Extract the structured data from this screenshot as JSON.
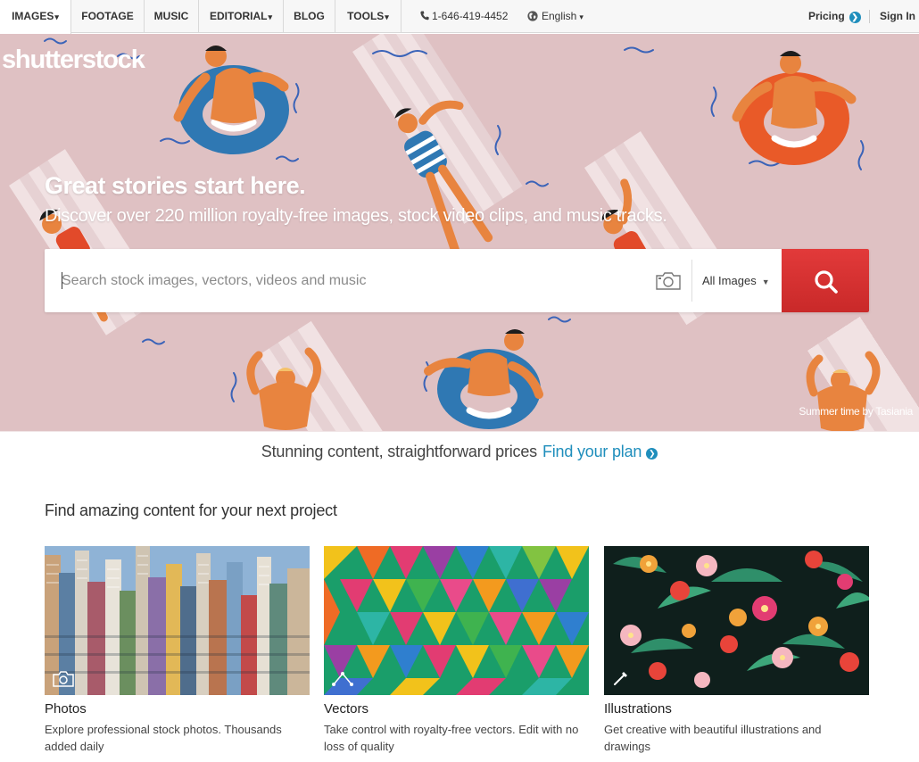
{
  "nav": {
    "items": [
      {
        "label": "IMAGES",
        "caret": "▾"
      },
      {
        "label": "FOOTAGE"
      },
      {
        "label": "MUSIC"
      },
      {
        "label": "EDITORIAL",
        "caret": "▾"
      },
      {
        "label": "BLOG"
      },
      {
        "label": "TOOLS",
        "caret": "▾"
      }
    ],
    "phone": "1-646-419-4452",
    "language": "English",
    "language_caret": "▾",
    "pricing": "Pricing",
    "sign_in": "Sign In"
  },
  "hero": {
    "logo": "shutterstock",
    "title": "Great stories start here.",
    "subtitle": "Discover over 220 million royalty-free images, stock video clips, and music tracks.",
    "search_placeholder": "Search stock images, vectors, videos and music",
    "search_type": "All Images",
    "credit": "Summer time by Tasiania",
    "background_color": "#dfc1c3"
  },
  "pricing_banner": {
    "text": "Stunning content, straightforward prices",
    "link": "Find your plan"
  },
  "content": {
    "heading": "Find amazing content for your next project",
    "cards": [
      {
        "title": "Photos",
        "description": "Explore professional stock photos. Thousands added daily",
        "badge_icon": "camera-icon"
      },
      {
        "title": "Vectors",
        "description": "Take control with royalty-free vectors. Edit with no loss of quality",
        "badge_icon": "pen-tool-icon"
      },
      {
        "title": "Illustrations",
        "description": "Get creative with beautiful illustrations and drawings",
        "badge_icon": "brush-icon"
      }
    ]
  },
  "colors": {
    "accent_blue": "#1f8ebc",
    "search_red": "#d93030"
  }
}
